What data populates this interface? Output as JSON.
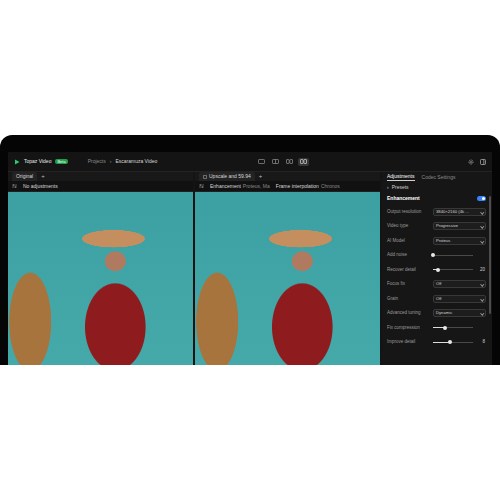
{
  "app": {
    "name": "Topaz Video",
    "badge": "Beta"
  },
  "breadcrumb": {
    "items": [
      "Projects",
      "Escaramuza Video"
    ],
    "separator": "›"
  },
  "view_buttons": [
    {
      "selected": false
    },
    {
      "selected": false
    },
    {
      "selected": false
    },
    {
      "selected": true
    }
  ],
  "panes": [
    {
      "tab": "Original",
      "add": "+",
      "notes": [
        {
          "label": "No adjustments"
        }
      ]
    },
    {
      "tab": "Upscale and 59.94",
      "add": "+",
      "notes": [
        {
          "label": "Enhancement",
          "value": "Proteus, Ma"
        },
        {
          "label": "Frame interpolation",
          "value": "Chronos"
        }
      ]
    }
  ],
  "sidebar": {
    "tabs": [
      {
        "label": "Adjustments",
        "selected": true
      },
      {
        "label": "Codec Settings",
        "selected": false
      }
    ],
    "presets": {
      "chevron": "›",
      "label": "Presets"
    },
    "section": {
      "label": "Enhancement",
      "on": true
    },
    "rows": [
      {
        "kind": "select",
        "label": "Output resolution",
        "value": "3840×2160 (4k ..."
      },
      {
        "kind": "select",
        "label": "Video type",
        "value": "Progressive"
      },
      {
        "kind": "select",
        "label": "AI Model",
        "value": "Proteus"
      },
      {
        "kind": "slider",
        "label": "Add noise",
        "level": 0.0
      },
      {
        "kind": "slider",
        "label": "Recover detail",
        "level": 0.12,
        "reading": "20"
      },
      {
        "kind": "select",
        "label": "Focus fix",
        "value": "Off"
      },
      {
        "kind": "select",
        "label": "Grain",
        "value": "Off"
      },
      {
        "kind": "select",
        "label": "Advanced tuning",
        "value": "Dynamic"
      },
      {
        "kind": "slider",
        "label": "Fix compression",
        "level": 0.3
      },
      {
        "kind": "slider",
        "label": "Improve detail",
        "level": 0.42,
        "reading": "8"
      }
    ]
  }
}
